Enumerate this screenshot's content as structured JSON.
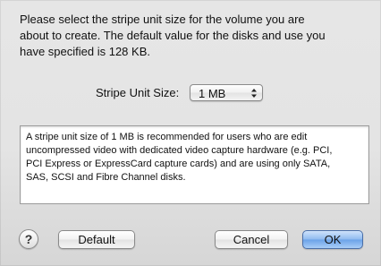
{
  "dialog": {
    "message_lines": [
      "Please select the stripe unit size for the volume you are",
      "about to create.  The default value for the disks and use you",
      "have specified is 128 KB."
    ],
    "stripe_label": "Stripe Unit Size:",
    "stripe_value": "1 MB",
    "info_lines": [
      "A stripe unit size of 1 MB is recommended for users who are edit",
      "uncompressed video with dedicated video capture hardware (e.g. PCI,",
      "PCI Express or ExpressCard capture cards) and are using only SATA,",
      "SAS, SCSI and Fibre Channel disks."
    ],
    "help_label": "?",
    "default_button": "Default",
    "cancel_button": "Cancel",
    "ok_button": "OK"
  },
  "colors": {
    "sheet_background": "#e4e4e4",
    "ok_button_accent": "#6aa2e8",
    "text": "#111111"
  }
}
